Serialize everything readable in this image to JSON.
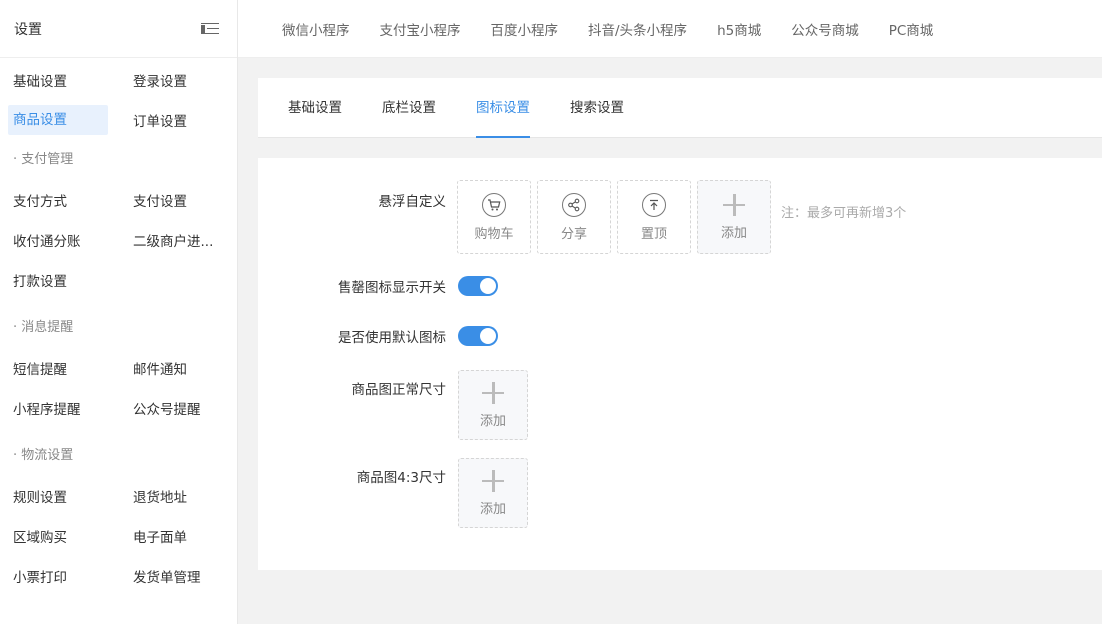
{
  "sidebar": {
    "title": "设置",
    "toggle_icon": "menu-fold-icon",
    "rows": [
      [
        "基础设置",
        "登录设置"
      ],
      [
        "商品设置",
        "订单设置"
      ]
    ],
    "group_pay": "· 支付管理",
    "pay_rows": [
      [
        "支付方式",
        "支付设置"
      ],
      [
        "收付通分账",
        "二级商户进..."
      ],
      [
        "打款设置",
        ""
      ]
    ],
    "group_msg": "· 消息提醒",
    "msg_rows": [
      [
        "短信提醒",
        "邮件通知"
      ],
      [
        "小程序提醒",
        "公众号提醒"
      ]
    ],
    "group_logistics": "· 物流设置",
    "logistics_rows": [
      [
        "规则设置",
        "退货地址"
      ],
      [
        "区域购买",
        "电子面单"
      ],
      [
        "小票打印",
        "发货单管理"
      ]
    ],
    "active_item": "商品设置"
  },
  "top_tabs": [
    "微信小程序",
    "支付宝小程序",
    "百度小程序",
    "抖音/头条小程序",
    "h5商城",
    "公众号商城",
    "PC商城"
  ],
  "sub_tabs": [
    "基础设置",
    "底栏设置",
    "图标设置",
    "搜索设置"
  ],
  "active_sub_tab": "图标设置",
  "form": {
    "float_label": "悬浮自定义",
    "float_items": [
      {
        "label": "购物车",
        "icon": "cart-icon"
      },
      {
        "label": "分享",
        "icon": "share-icon"
      },
      {
        "label": "置顶",
        "icon": "arrow-top-icon"
      }
    ],
    "add_label": "添加",
    "note": "注：最多可再新增3个",
    "sold_out_label": "售罄图标显示开关",
    "sold_out_on": true,
    "default_icon_label": "是否使用默认图标",
    "default_icon_on": true,
    "normal_size_label": "商品图正常尺寸",
    "ratio_size_label": "商品图4:3尺寸"
  },
  "colors": {
    "accent": "#3a8ee6",
    "active_bg": "#e8f1fd"
  }
}
